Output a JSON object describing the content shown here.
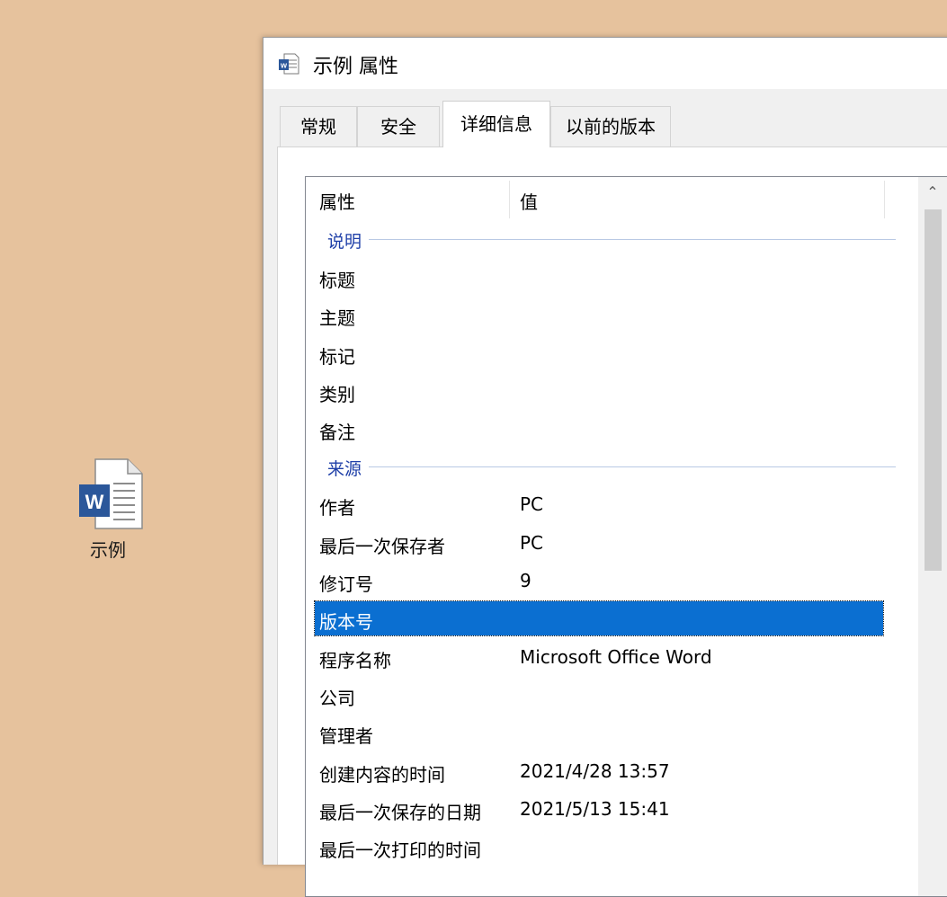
{
  "desktop": {
    "icon_label": "示例",
    "icon_letter": "W"
  },
  "window": {
    "title": "示例 属性",
    "title_icon": "word-doc-icon"
  },
  "tabs": [
    {
      "label": "常规"
    },
    {
      "label": "安全"
    },
    {
      "label": "详细信息",
      "active": true
    },
    {
      "label": "以前的版本"
    }
  ],
  "details": {
    "columns": {
      "property": "属性",
      "value": "值"
    },
    "groups": {
      "description": {
        "title": "说明",
        "rows": [
          {
            "key": "标题",
            "value": ""
          },
          {
            "key": "主题",
            "value": ""
          },
          {
            "key": "标记",
            "value": ""
          },
          {
            "key": "类别",
            "value": ""
          },
          {
            "key": "备注",
            "value": ""
          }
        ]
      },
      "origin": {
        "title": "来源",
        "rows": [
          {
            "key": "作者",
            "value": "PC"
          },
          {
            "key": "最后一次保存者",
            "value": "PC"
          },
          {
            "key": "修订号",
            "value": "9"
          },
          {
            "key": "版本号",
            "value": "",
            "selected": true
          },
          {
            "key": "程序名称",
            "value": "Microsoft Office Word"
          },
          {
            "key": "公司",
            "value": ""
          },
          {
            "key": "管理者",
            "value": ""
          },
          {
            "key": "创建内容的时间",
            "value": "2021/4/28 13:57"
          },
          {
            "key": "最后一次保存的日期",
            "value": "2021/5/13 15:41"
          },
          {
            "key": "最后一次打印的时间",
            "value": ""
          }
        ]
      }
    }
  },
  "scrollbar": {
    "up_arrow_icon": "chevron-up-icon"
  },
  "colors": {
    "desktop_bg": "#e6c29d",
    "selection": "#0b6fd1",
    "group_title": "#1e3fa8",
    "word_blue": "#2b579a"
  }
}
